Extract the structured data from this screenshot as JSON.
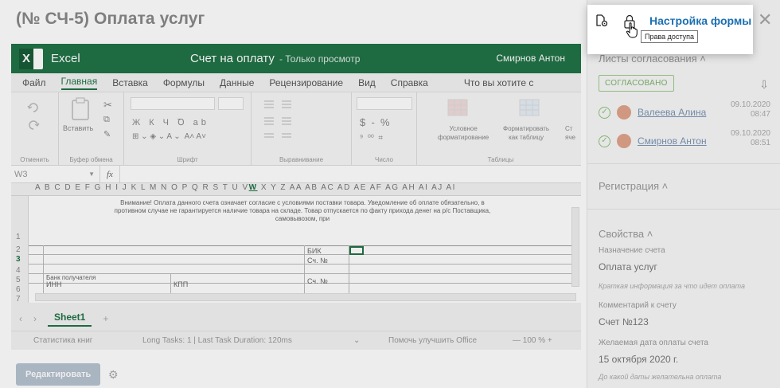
{
  "page": {
    "title": "(№ СЧ-5) Оплата услуг"
  },
  "popup": {
    "title": "Настройка формы",
    "tooltip": "Права доступа"
  },
  "ui": {
    "close": "✕"
  },
  "actions": {
    "edit": "Редактировать"
  },
  "excel": {
    "app_name": "Excel",
    "doc_title": "Счет на оплату",
    "view_mode": "-  Только просмотр",
    "user": "Смирнов Антон",
    "tabs": [
      "Файл",
      "Главная",
      "Вставка",
      "Формулы",
      "Данные",
      "Рецензирование",
      "Вид",
      "Справка"
    ],
    "tell_me": "Что вы хотите с",
    "ribbon": {
      "undo": "Отменить",
      "clipboard": "Буфер обмена",
      "font": "Шрифт",
      "alignment": "Выравнивание",
      "number": "Число",
      "tables": "Таблицы",
      "paste": "Вставить",
      "font_styles": "Ж К Ч Ꝺ ab",
      "font_tools": "⊞ ⌄ ◈ ⌄ A ⌄  A˄ A˅",
      "number_symbols": "$  -  %",
      "decimal_tools": "⁹  ⁰⁰  ⌗",
      "conditional": "Условное\nформатирование",
      "format_table": "Форматировать\nкак таблицу",
      "cell_styles": "Ст\nяче"
    },
    "cell_ref": "W3",
    "fx": "fx",
    "columns_left": "A B C D E F G H I J K L M N O P Q R S T U V",
    "column_selected": "W",
    "columns_right": "X Y Z AA AB AC AD AE AF AG AH AI AJ AI",
    "rows": [
      "1",
      "2",
      "3",
      "4",
      "5",
      "6",
      "7"
    ],
    "notice": "Внимание! Оплата данного счета означает согласие с условиями поставки товара. Уведомление об оплате обязательно, в противном случае не гарантируется наличие товара на складе. Товар отпускается по факту прихода денег на р/с Поставщика, самовывозом, при",
    "cells": {
      "bik": "БИК",
      "account": "Сч. №",
      "bank": "Банк получателя",
      "inn": "ИНН",
      "kpp": "КПП"
    },
    "sheet": "Sheet1",
    "status": {
      "stats": "Статистика книг",
      "tasks": "Long Tasks: 1 | Last Task Duration: 120ms",
      "feedback": "Помочь улучшить Office",
      "zoom": "—  100 %  +"
    }
  },
  "panel": {
    "approval_title": "Листы согласования ˄",
    "status": "СОГЛАСОВАНО",
    "approvers": [
      {
        "name": "Валеева Алина",
        "date": "09.10.2020",
        "time": "08:47"
      },
      {
        "name": "Смирнов Антон",
        "date": "09.10.2020",
        "time": "08:51"
      }
    ],
    "registration_title": "Регистрация ˄",
    "properties_title": "Свойства ˄",
    "props": [
      {
        "label": "Назначение счета",
        "value": "Оплата услуг",
        "hint": "Краткая информация за что идет оплата"
      },
      {
        "label": "Комментарий к счету",
        "value": "Счет №123"
      },
      {
        "label": "Желаемая дата оплаты счета",
        "value": "15 октября 2020 г.",
        "hint": "До какой даты желательна оплата"
      }
    ]
  }
}
